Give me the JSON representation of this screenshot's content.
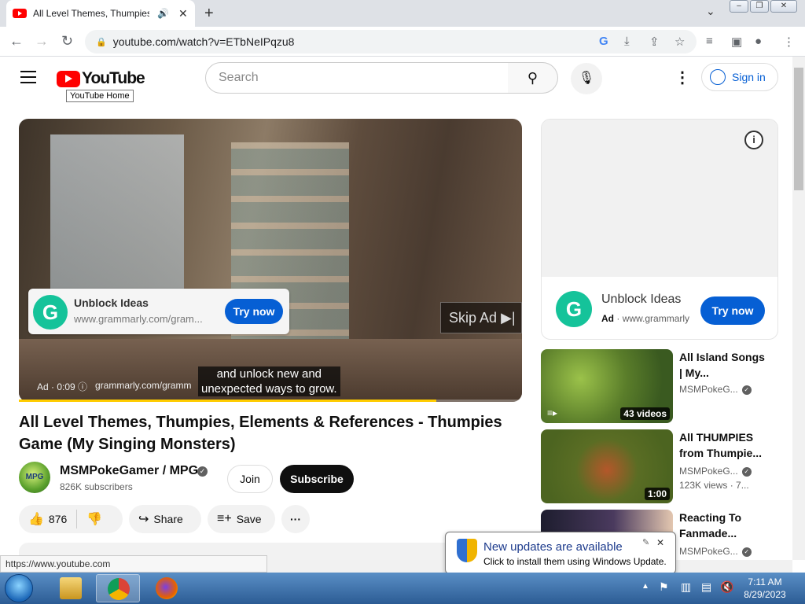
{
  "browser": {
    "tab_title": "All Level Themes, Thumpies,",
    "url": "youtube.com/watch?v=ETbNeIPqzu8",
    "status_url": "https://www.youtube.com"
  },
  "header": {
    "logo_text": "YouTube",
    "tooltip": "YouTube Home",
    "search_placeholder": "Search",
    "signin_label": "Sign in"
  },
  "player": {
    "ad_card": {
      "title": "Unblock Ideas",
      "domain": "www.grammarly.com/gram...",
      "cta": "Try now",
      "logo_letter": "G"
    },
    "skip_label": "Skip Ad",
    "caption_lines": [
      "and unlock new and",
      "unexpected ways to grow."
    ],
    "ad_info": "Ad · 0:09",
    "ad_site": "grammarly.com/gramm",
    "progress_fraction": 0.83
  },
  "video": {
    "title": "All Level Themes, Thumpies, Elements & References - Thumpies Game (My Singing Monsters)",
    "channel": "MSMPokeGamer / MPG",
    "channel_avatar_text": "MPG",
    "subscribers": "826K subscribers",
    "join_label": "Join",
    "subscribe_label": "Subscribe",
    "likes": "876",
    "share_label": "Share",
    "save_label": "Save"
  },
  "side_ad": {
    "title": "Unblock Ideas",
    "ad_label": "Ad",
    "domain": "www.grammarly",
    "cta": "Try now",
    "logo_letter": "G"
  },
  "recommendations": [
    {
      "title": "All Island Songs | My...",
      "channel": "MSMPokeG...",
      "meta": "",
      "badge": "43 videos"
    },
    {
      "title": "All THUMPIES from Thumpie...",
      "channel": "MSMPokeG...",
      "meta": "123K views · 7...",
      "badge": "1:00"
    },
    {
      "title": "Reacting To Fanmade...",
      "channel": "MSMPokeG...",
      "meta": "",
      "badge": ""
    }
  ],
  "notification": {
    "title": "New updates are available",
    "subtitle": "Click to install them using Windows Update."
  },
  "taskbar": {
    "time": "7:11 AM",
    "date": "8/29/2023"
  },
  "colors": {
    "youtube_red": "#ff0000",
    "accent_blue": "#065fd4",
    "grammarly_green": "#15c39a"
  }
}
